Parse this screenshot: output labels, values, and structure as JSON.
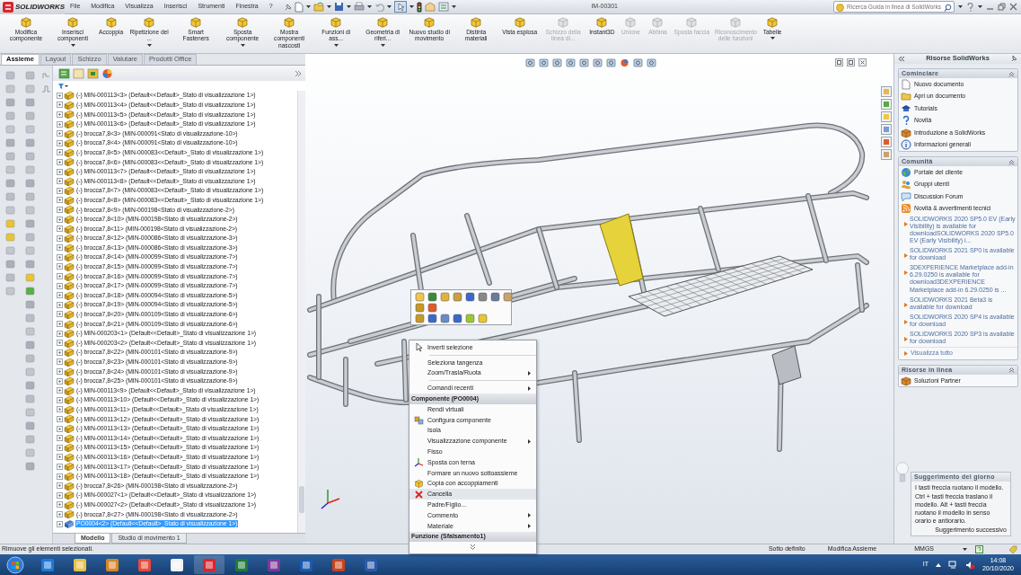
{
  "titlebar": {
    "logo": "SOLIDWORKS",
    "menus": [
      "File",
      "Modifica",
      "Visualizza",
      "Inserisci",
      "Strumenti",
      "Finestra",
      "?"
    ],
    "document": "IM-00301",
    "search": {
      "placeholder": "Ricerca Guida in linea di SolidWorks"
    }
  },
  "ribbon": [
    {
      "label": "Modifica componente",
      "disabled": false,
      "dropdown": false
    },
    {
      "label": "Inserisci componenti",
      "disabled": false,
      "dropdown": true
    },
    {
      "label": "Accoppia",
      "disabled": false,
      "dropdown": false
    },
    {
      "label": "Ripetizione del ...",
      "disabled": false,
      "dropdown": true
    },
    {
      "label": "Smart Fasteners",
      "disabled": false,
      "dropdown": false
    },
    {
      "label": "Sposta componente",
      "disabled": false,
      "dropdown": true
    },
    {
      "label": "Mostra componenti nascosti",
      "disabled": false,
      "dropdown": false
    },
    {
      "label": "Funzioni di ass...",
      "disabled": false,
      "dropdown": true
    },
    {
      "label": "Geometria di riferi...",
      "disabled": false,
      "dropdown": true
    },
    {
      "label": "Nuovo studio di movimento",
      "disabled": false,
      "dropdown": false
    },
    {
      "label": "Distinta materiali",
      "disabled": false,
      "dropdown": false
    },
    {
      "label": "Vista esplosa",
      "disabled": false,
      "dropdown": false
    },
    {
      "label": "Schizzo della linea di...",
      "disabled": true,
      "dropdown": false
    },
    {
      "label": "Instant3D",
      "disabled": false,
      "dropdown": false
    },
    {
      "label": "Unione",
      "disabled": true,
      "dropdown": false
    },
    {
      "label": "Abbina",
      "disabled": true,
      "dropdown": false
    },
    {
      "label": "Sposta faccia",
      "disabled": true,
      "dropdown": false
    },
    {
      "label": "Riconoscimento delle funzioni",
      "disabled": true,
      "dropdown": false
    },
    {
      "label": "Tabelle",
      "disabled": false,
      "dropdown": true
    }
  ],
  "tabs": [
    {
      "label": "Assieme",
      "selected": true
    },
    {
      "label": "Layout",
      "selected": false
    },
    {
      "label": "Schizzo",
      "selected": false
    },
    {
      "label": "Valutare",
      "selected": false
    },
    {
      "label": "Prodotti Office",
      "selected": false
    }
  ],
  "tree": {
    "rows": [
      {
        "label": "(-) MIN-000113<3> (Default<<Default>_Stato di visualizzazione 1>)",
        "selected": false
      },
      {
        "label": "(-) MIN-000113<4> (Default<<Default>_Stato di visualizzazione 1>)",
        "selected": false
      },
      {
        "label": "(-) MIN-000113<5> (Default<<Default>_Stato di visualizzazione 1>)",
        "selected": false
      },
      {
        "label": "(-) MIN-000113<6> (Default<<Default>_Stato di visualizzazione 1>)",
        "selected": false
      },
      {
        "label": "(-) brocca7,8<3> (MIN-000091<Stato di visualizzazione-10>)",
        "selected": false
      },
      {
        "label": "(-) brocca7,8<4> (MIN-000091<Stato di visualizzazione-10>)",
        "selected": false
      },
      {
        "label": "(-) brocca7,8<5> (MIN-000083<<Default>_Stato di visualizzazione 1>)",
        "selected": false
      },
      {
        "label": "(-) brocca7,8<6> (MIN-000083<<Default>_Stato di visualizzazione 1>)",
        "selected": false
      },
      {
        "label": "(-) MIN-000113<7> (Default<<Default>_Stato di visualizzazione 1>)",
        "selected": false
      },
      {
        "label": "(-) MIN-000113<8> (Default<<Default>_Stato di visualizzazione 1>)",
        "selected": false
      },
      {
        "label": "(-) brocca7,8<7> (MIN-000083<<Default>_Stato di visualizzazione 1>)",
        "selected": false
      },
      {
        "label": "(-) brocca7,8<8> (MIN-000083<<Default>_Stato di visualizzazione 1>)",
        "selected": false
      },
      {
        "label": "(-) brocca7,8<9> (MIN-000198<Stato di visualizzazione-2>)",
        "selected": false
      },
      {
        "label": "(-) brocca7,8<10> (MIN-000198<Stato di visualizzazione-2>)",
        "selected": false
      },
      {
        "label": "(-) brocca7,8<11> (MIN-000198<Stato di visualizzazione-2>)",
        "selected": false
      },
      {
        "label": "(-) brocca7,8<12> (MIN-000086<Stato di visualizzazione-3>)",
        "selected": false
      },
      {
        "label": "(-) brocca7,8<13> (MIN-000086<Stato di visualizzazione-3>)",
        "selected": false
      },
      {
        "label": "(-) brocca7,8<14> (MIN-000099<Stato di visualizzazione-7>)",
        "selected": false
      },
      {
        "label": "(-) brocca7,8<15> (MIN-000099<Stato di visualizzazione-7>)",
        "selected": false
      },
      {
        "label": "(-) brocca7,8<16> (MIN-000099<Stato di visualizzazione-7>)",
        "selected": false
      },
      {
        "label": "(-) brocca7,8<17> (MIN-000099<Stato di visualizzazione-7>)",
        "selected": false
      },
      {
        "label": "(-) brocca7,8<18> (MIN-000094<Stato di visualizzazione-5>)",
        "selected": false
      },
      {
        "label": "(-) brocca7,8<19> (MIN-000094<Stato di visualizzazione-5>)",
        "selected": false
      },
      {
        "label": "(-) brocca7,8<20> (MIN-000109<Stato di visualizzazione-6>)",
        "selected": false
      },
      {
        "label": "(-) brocca7,8<21> (MIN-000109<Stato di visualizzazione-6>)",
        "selected": false
      },
      {
        "label": "(-) MIN-000203<1> (Default<<Default>_Stato di visualizzazione 1>)",
        "selected": false
      },
      {
        "label": "(-) MIN-000203<2> (Default<<Default>_Stato di visualizzazione 1>)",
        "selected": false
      },
      {
        "label": "(-) brocca7,8<22> (MIN-000101<Stato di visualizzazione-9>)",
        "selected": false
      },
      {
        "label": "(-) brocca7,8<23> (MIN-000101<Stato di visualizzazione-9>)",
        "selected": false
      },
      {
        "label": "(-) brocca7,8<24> (MIN-000101<Stato di visualizzazione-9>)",
        "selected": false
      },
      {
        "label": "(-) brocca7,8<25> (MIN-000101<Stato di visualizzazione-9>)",
        "selected": false
      },
      {
        "label": "(-) MIN-000113<9> (Default<<Default>_Stato di visualizzazione 1>)",
        "selected": false
      },
      {
        "label": "(-) MIN-000113<10> (Default<<Default>_Stato di visualizzazione 1>)",
        "selected": false
      },
      {
        "label": "(-) MIN-000113<11> (Default<<Default>_Stato di visualizzazione 1>)",
        "selected": false
      },
      {
        "label": "(-) MIN-000113<12> (Default<<Default>_Stato di visualizzazione 1>)",
        "selected": false
      },
      {
        "label": "(-) MIN-000113<13> (Default<<Default>_Stato di visualizzazione 1>)",
        "selected": false
      },
      {
        "label": "(-) MIN-000113<14> (Default<<Default>_Stato di visualizzazione 1>)",
        "selected": false
      },
      {
        "label": "(-) MIN-000113<15> (Default<<Default>_Stato di visualizzazione 1>)",
        "selected": false
      },
      {
        "label": "(-) MIN-000113<16> (Default<<Default>_Stato di visualizzazione 1>)",
        "selected": false
      },
      {
        "label": "(-) MIN-000113<17> (Default<<Default>_Stato di visualizzazione 1>)",
        "selected": false
      },
      {
        "label": "(-) MIN-000113<18> (Default<<Default>_Stato di visualizzazione 1>)",
        "selected": false
      },
      {
        "label": "(-) brocca7,8<26> (MIN-000198<Stato di visualizzazione-2>)",
        "selected": false
      },
      {
        "label": "(-) MIN-000027<1> (Default<<Default>_Stato di visualizzazione 1>)",
        "selected": false
      },
      {
        "label": "(-) MIN-000027<2> (Default<<Default>_Stato di visualizzazione 1>)",
        "selected": false
      },
      {
        "label": "(-) brocca7,8<27> (MIN-000198<Stato di visualizzazione-2>)",
        "selected": false
      },
      {
        "label": "PO0004<2> (Default<<Default>_Stato di visualizzazione 1>)",
        "selected": true
      }
    ]
  },
  "bottom_tabs": [
    {
      "label": "Modello",
      "selected": true
    },
    {
      "label": "Studio di movimento 1",
      "selected": false
    }
  ],
  "context_menu": {
    "items": [
      {
        "kind": "item",
        "label": "Inverti selezione",
        "submenu": false,
        "hover": false
      },
      {
        "kind": "separator"
      },
      {
        "kind": "item",
        "label": "Seleziona tangenza",
        "submenu": false,
        "hover": false
      },
      {
        "kind": "item",
        "label": "Zoom/Trasla/Ruota",
        "submenu": true,
        "hover": false
      },
      {
        "kind": "separator"
      },
      {
        "kind": "item",
        "label": "Comandi recenti",
        "submenu": true,
        "hover": false
      },
      {
        "kind": "header",
        "label": "Componente (PO0004)"
      },
      {
        "kind": "item",
        "label": "Rendi virtuali",
        "submenu": false,
        "hover": false
      },
      {
        "kind": "item",
        "label": "Configura componente",
        "submenu": false,
        "hover": false
      },
      {
        "kind": "item",
        "label": "Isola",
        "submenu": false,
        "hover": false
      },
      {
        "kind": "item",
        "label": "Visualizzazione componente",
        "submenu": true,
        "hover": false
      },
      {
        "kind": "item",
        "label": "Fisso",
        "submenu": false,
        "hover": false
      },
      {
        "kind": "item",
        "label": "Sposta con terna",
        "submenu": false,
        "hover": false
      },
      {
        "kind": "item",
        "label": "Formare un nuovo sottoassieme",
        "submenu": false,
        "hover": false
      },
      {
        "kind": "item",
        "label": "Copia con accoppiamenti",
        "submenu": false,
        "hover": false
      },
      {
        "kind": "item",
        "label": "Cancella",
        "submenu": false,
        "hover": true
      },
      {
        "kind": "item",
        "label": "Padre/Figlio...",
        "submenu": false,
        "hover": false
      },
      {
        "kind": "item",
        "label": "Commento",
        "submenu": true,
        "hover": false
      },
      {
        "kind": "item",
        "label": "Materiale",
        "submenu": true,
        "hover": false
      },
      {
        "kind": "header",
        "label": "Funzione (Sfalsamento1)"
      }
    ]
  },
  "task_pane": {
    "title": "Risorse SolidWorks",
    "sections": [
      {
        "title": "Cominciare",
        "items": [
          {
            "label": "Nuovo documento"
          },
          {
            "label": "Apri un documento"
          },
          {
            "label": "Tutorials"
          },
          {
            "label": "Novità"
          },
          {
            "label": "Introduzione a SolidWorks"
          },
          {
            "label": "Informazioni generali"
          }
        ]
      },
      {
        "title": "Comunità",
        "items": [
          {
            "label": "Portale del cliente"
          },
          {
            "label": "Gruppi utenti"
          },
          {
            "label": "Discussion Forum"
          },
          {
            "label": "Novità & avvertimenti tecnici"
          }
        ],
        "news": [
          "SOLIDWORKS 2020 SP5.0 EV (Early Visibility) is available for downloadSOLIDWORKS 2020 SP5.0 EV (Early Visibility) i...",
          "SOLIDWORKS 2021 SP0 is available for download",
          "3DEXPERIENCE Marketplace add-in 6.29.0250 is available for download3DEXPERIENCE Marketplace add-in 6.29.0250 is ...",
          "SOLIDWORKS 2021 Beta3 is available for download",
          "SOLIDWORKS 2020 SP4 is available for download",
          "SOLIDWORKS 2020 SP3 is available for download"
        ],
        "more": "Visualizza tutto"
      },
      {
        "title": "Risorse in linea",
        "items": [
          {
            "label": "Soluzioni Partner"
          }
        ]
      }
    ],
    "tip": {
      "title": "Suggerimento del giorno",
      "text": "I tasti freccia ruotano il modello. Ctrl + tasti freccia traslano il modello. Alt + tasti freccia ruotano il modello in senso orario e antiorario.",
      "next": "Suggerimento successivo"
    }
  },
  "status_bar": {
    "message": "Rimuove gli elementi selezionati.",
    "state": "Sotto definito",
    "mode": "Modifica Assieme",
    "units": "MMGS"
  },
  "taskbar": {
    "language": "IT",
    "time": "14:08",
    "date": "20/10/2020"
  }
}
